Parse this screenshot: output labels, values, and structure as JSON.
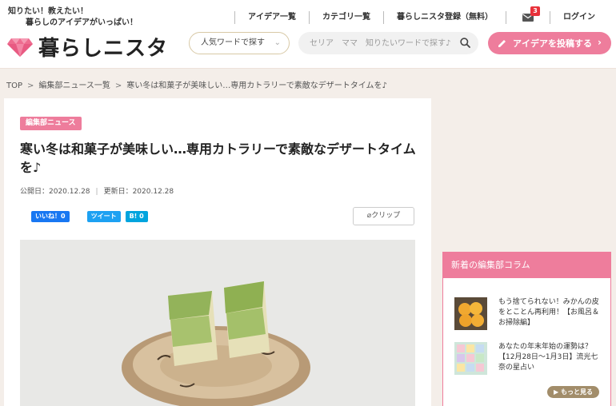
{
  "header": {
    "tagline_line1": "知りたい！教えたい！",
    "tagline_line2": "暮らしのアイデアがいっぱい！",
    "logo_text": "暮らしニスタ",
    "nav": [
      "アイデア一覧",
      "カテゴリ一覧",
      "暮らしニスタ登録（無料）"
    ],
    "mail_count": "3",
    "login": "ログイン",
    "popular_label": "人気ワードで探す",
    "search_placeholder": "セリア　ママ　知りたいワードで探す♪",
    "post_button": "アイデアを投稿する",
    "accent_color": "#ee7d9c"
  },
  "breadcrumb": [
    "TOP",
    "編集部ニュース一覧",
    "寒い冬は和菓子が美味しい…専用カトラリーで素敵なデザートタイムを♪"
  ],
  "article": {
    "category": "編集部ニュース",
    "title": "寒い冬は和菓子が美味しい…専用カトラリーで素敵なデザートタイムを♪",
    "published": "公開日：2020.12.28",
    "updated": "更新日：2020.12.28",
    "like": "いいね！0",
    "tweet": "ツイート",
    "hatena": "B! 0",
    "clip": "クリップ"
  },
  "sidebar": {
    "heading": "新着の編集部コラム",
    "items": [
      {
        "text": "もう捨てられない！みかんの皮をとことん再利用！【お風呂＆お掃除編】"
      },
      {
        "text": "あなたの年末年始の運勢は？【12月28日～1月3日】流光七奈の星占い"
      }
    ],
    "more": "もっと見る"
  }
}
